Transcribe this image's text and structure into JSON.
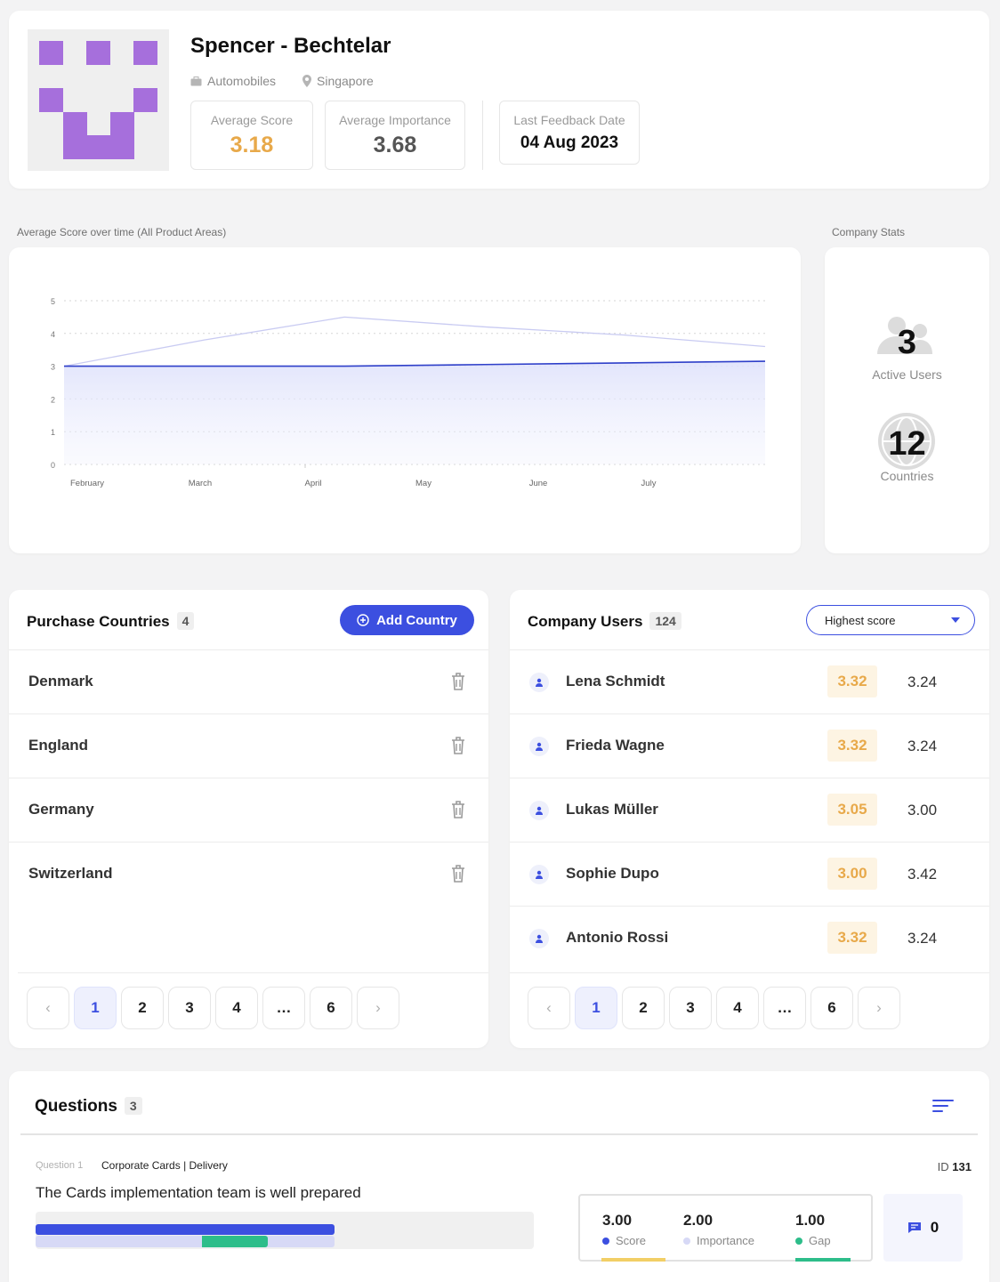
{
  "company": {
    "name": "Spencer - Bechtelar",
    "industry": "Automobiles",
    "location": "Singapore",
    "avg_score_label": "Average Score",
    "avg_score": "3.18",
    "avg_importance_label": "Average Importance",
    "avg_importance": "3.68",
    "last_feedback_label": "Last Feedback Date",
    "last_feedback": "04 Aug 2023",
    "accent_color": "#e8a94a",
    "avatar_color": "#a66fdc"
  },
  "chart_section_label": "Average Score over time (All Product Areas)",
  "chart_data": {
    "type": "area",
    "x": [
      "February",
      "March",
      "April",
      "May",
      "June",
      "July"
    ],
    "yticks": [
      "5",
      "4",
      "3",
      "2",
      "1",
      "0"
    ],
    "ylim": [
      0,
      5
    ],
    "grid": true,
    "series": [
      {
        "values": [
          3.0,
          3.0,
          3.0,
          3.05,
          3.1,
          3.15
        ],
        "color": "#2e3fc9"
      },
      {
        "values": [
          3.0,
          3.8,
          4.5,
          4.2,
          3.95,
          3.6
        ],
        "color": "#c9cbf2"
      }
    ]
  },
  "stats_section_label": "Company Stats",
  "stats": {
    "active_users": "3",
    "active_users_label": "Active Users",
    "countries": "12",
    "countries_label": "Countries"
  },
  "countries": {
    "title": "Purchase Countries",
    "count": "4",
    "add_label": "Add Country",
    "items": [
      "Denmark",
      "England",
      "Germany",
      "Switzerland"
    ]
  },
  "users": {
    "title": "Company Users",
    "count": "124",
    "sort_selected": "Highest score",
    "items": [
      {
        "name": "Lena Schmidt",
        "score": "3.32",
        "importance": "3.24"
      },
      {
        "name": "Frieda Wagne",
        "score": "3.32",
        "importance": "3.24"
      },
      {
        "name": "Lukas Müller",
        "score": "3.05",
        "importance": "3.00"
      },
      {
        "name": "Sophie Dupo",
        "score": "3.00",
        "importance": "3.42"
      },
      {
        "name": "Antonio Rossi",
        "score": "3.32",
        "importance": "3.24"
      }
    ]
  },
  "pagination": {
    "pages": [
      "1",
      "2",
      "3",
      "4",
      "…",
      "6"
    ],
    "prev": "‹",
    "next": "›"
  },
  "questions": {
    "title": "Questions",
    "count": "3",
    "items": [
      {
        "number": "Question 1",
        "tag1": "Corporate Cards",
        "tag2": "Delivery",
        "id_label": "ID",
        "id": "131",
        "text": "The Cards implementation team is well prepared",
        "score": "3.00",
        "score_label": "Score",
        "importance": "2.00",
        "importance_label": "Importance",
        "gap": "1.00",
        "gap_label": "Gap",
        "comments": "0"
      }
    ]
  },
  "colors": {
    "primary": "#3c4fe0",
    "score": "#e8a94a",
    "gap": "#2dbd8a",
    "importance": "#d7d9f6"
  }
}
